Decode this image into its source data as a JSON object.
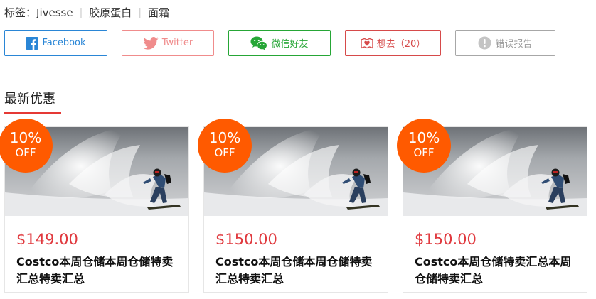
{
  "tags": {
    "prefix": "标签：",
    "items": [
      "Jivesse",
      "胶原蛋白",
      "面霜"
    ]
  },
  "share": {
    "facebook": "Facebook",
    "twitter": "Twitter",
    "wechat": "微信好友",
    "want": "想去（20）",
    "error": "错误报告"
  },
  "section": {
    "title": "最新优惠"
  },
  "deals": [
    {
      "pct": "10%",
      "off": "OFF",
      "price": "$149.00",
      "title": "Costco本周仓储本周仓储特卖汇总特卖汇总"
    },
    {
      "pct": "10%",
      "off": "OFF",
      "price": "$150.00",
      "title": "Costco本周仓储本周仓储特卖汇总特卖汇总"
    },
    {
      "pct": "10%",
      "off": "OFF",
      "price": "$150.00",
      "title": "Costco本周仓储特卖汇总本周仓储特卖汇总"
    }
  ],
  "colors": {
    "badge": "#ff5a00",
    "price": "#e0393e",
    "accent_line": "#e53935",
    "facebook": "#2a86d6",
    "twitter": "#f08c8c",
    "wechat": "#26a636",
    "want": "#d64a4a",
    "error": "#999999"
  }
}
